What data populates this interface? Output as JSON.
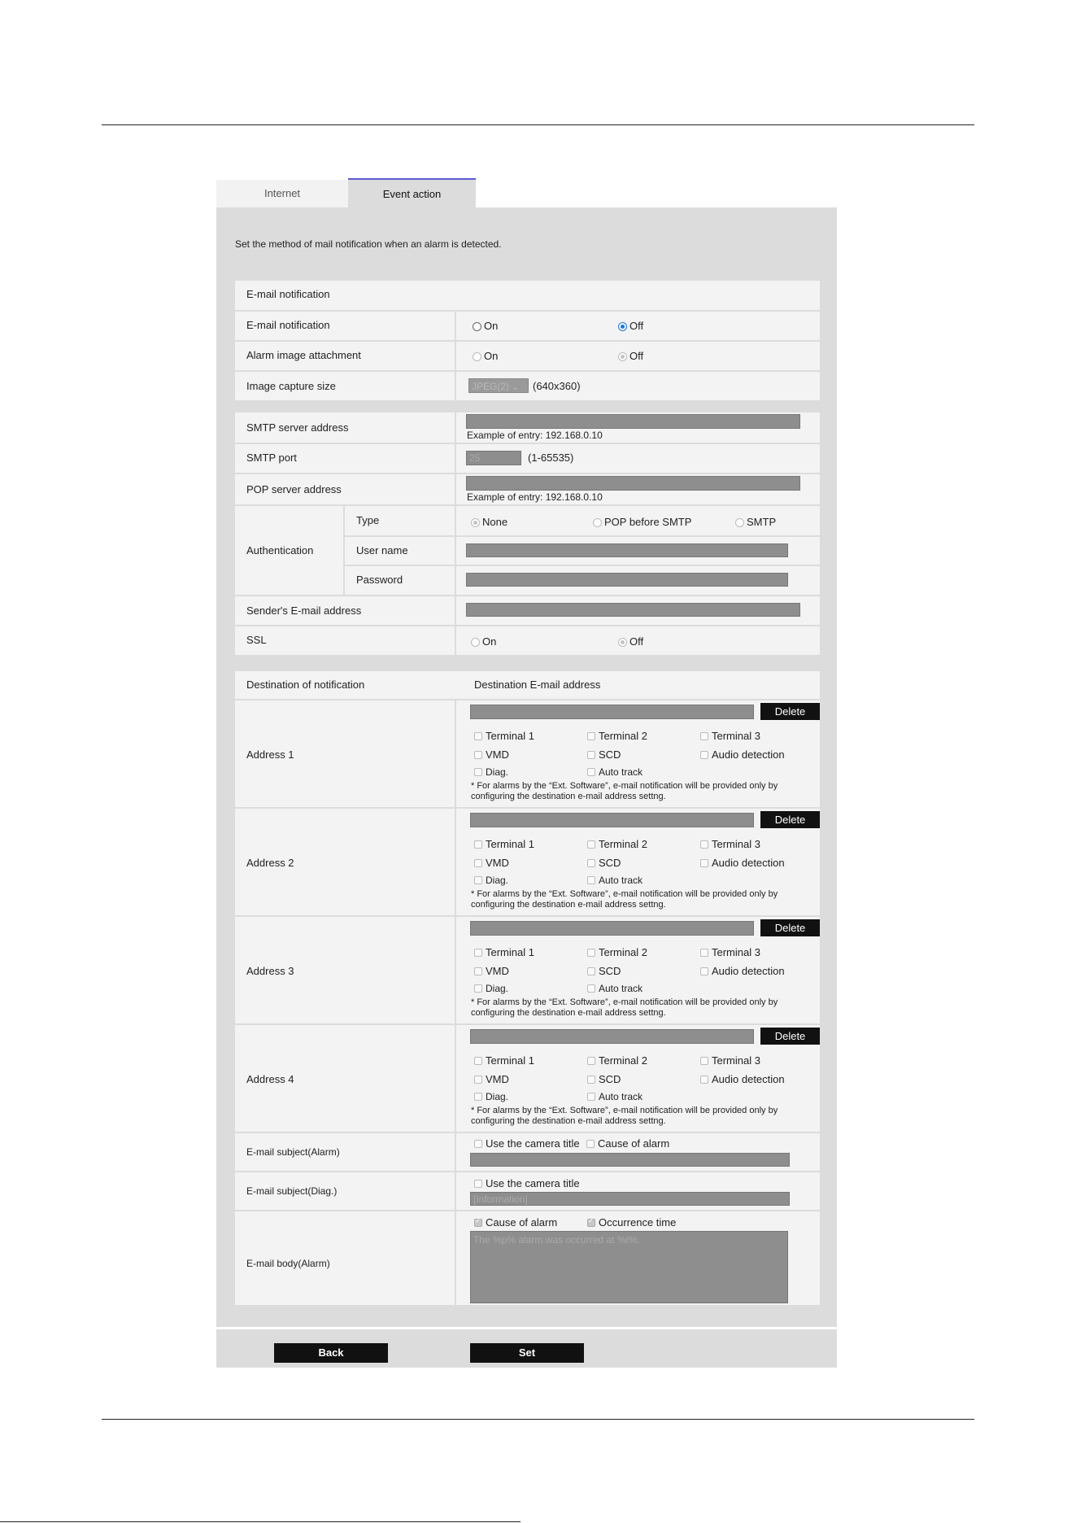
{
  "tabs": {
    "internet": "Internet",
    "event_action": "Event action"
  },
  "intro": "Set the method of mail notification when an alarm is detected.",
  "email": {
    "header": "E-mail notification",
    "notify_label": "E-mail notification",
    "on": "On",
    "off": "Off",
    "attach_label": "Alarm image attachment",
    "capture_label": "Image capture size",
    "capture_select": "JPEG(2)",
    "capture_res": "(640x360)"
  },
  "smtp": {
    "server_label": "SMTP server address",
    "example": "Example of entry: 192.168.0.10",
    "port_label": "SMTP port",
    "port_value": "25",
    "port_range": "(1-65535)",
    "pop_label": "POP server address",
    "auth_label": "Authentication",
    "type_label": "Type",
    "type_none": "None",
    "type_pop": "POP before SMTP",
    "type_smtp": "SMTP",
    "user_label": "User name",
    "pass_label": "Password",
    "sender_label": "Sender's E-mail address",
    "ssl_label": "SSL"
  },
  "dest": {
    "header_left": "Destination of notification",
    "header_right": "Destination E-mail address",
    "delete": "Delete",
    "t1": "Terminal 1",
    "t2": "Terminal 2",
    "t3": "Terminal 3",
    "vmd": "VMD",
    "scd": "SCD",
    "audio": "Audio detection",
    "diag": "Diag.",
    "auto": "Auto track",
    "note1": "* For alarms by the “Ext. Software”, e-mail notification will be provided only by",
    "note2": "configuring the destination e-mail address settng.",
    "addresses": [
      "Address 1",
      "Address 2",
      "Address 3",
      "Address 4"
    ]
  },
  "subject": {
    "alarm_label": "E-mail subject(Alarm)",
    "use_title": "Use the camera title",
    "cause": "Cause of alarm",
    "diag_label": "E-mail subject(Diag.)",
    "diag_value": "[Information]"
  },
  "body": {
    "label": "E-mail body(Alarm)",
    "cause": "Cause of alarm",
    "occurrence": "Occurrence time",
    "text": "The %p% alarm was occurred at %t%."
  },
  "buttons": {
    "back": "Back",
    "set": "Set"
  }
}
